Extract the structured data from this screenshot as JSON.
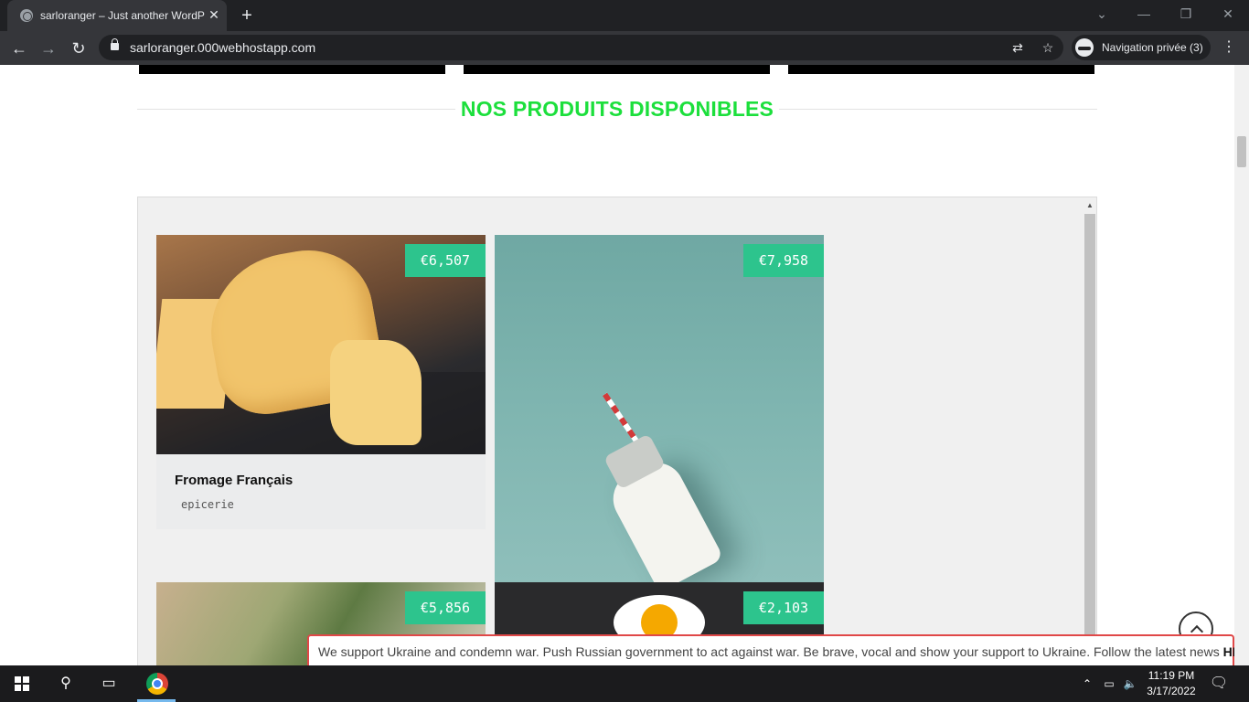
{
  "browser": {
    "tab_title": "sarloranger – Just another WordPress site",
    "tab_close": "✕",
    "new_tab": "+",
    "url": "sarloranger.000webhostapp.com",
    "profile_label": "Navigation privée (3)",
    "window_controls": [
      "⌄",
      "—",
      "❐",
      "✕"
    ],
    "nav": {
      "back": "←",
      "forward": "→",
      "reload": "↻"
    },
    "menu": "⋮"
  },
  "page": {
    "section_title": "NOS PRODUITS DISPONIBLES",
    "products": [
      {
        "name": "Fromage Français",
        "category": "epicerie",
        "price": "€6,507"
      },
      {
        "name": "",
        "category": "",
        "price": "€7,958"
      },
      {
        "name": "",
        "category": "",
        "price": "€5,856"
      },
      {
        "name": "",
        "category": "",
        "price": "€2,103"
      }
    ],
    "banner": {
      "text": "We support Ukraine and condemn war. Push Russian government to act against war. Be brave, vocal and show your support to Ukraine. Follow the latest news ",
      "link": "HERE"
    }
  },
  "taskbar": {
    "time": "11:19 PM",
    "date": "3/17/2022",
    "icons": [
      "windows-start-icon",
      "search-icon",
      "task-view-icon",
      "chrome-icon"
    ]
  },
  "colors": {
    "accent_green": "#1cdf3c",
    "price_badge": "#2dc48d",
    "banner_border": "#e04848"
  }
}
